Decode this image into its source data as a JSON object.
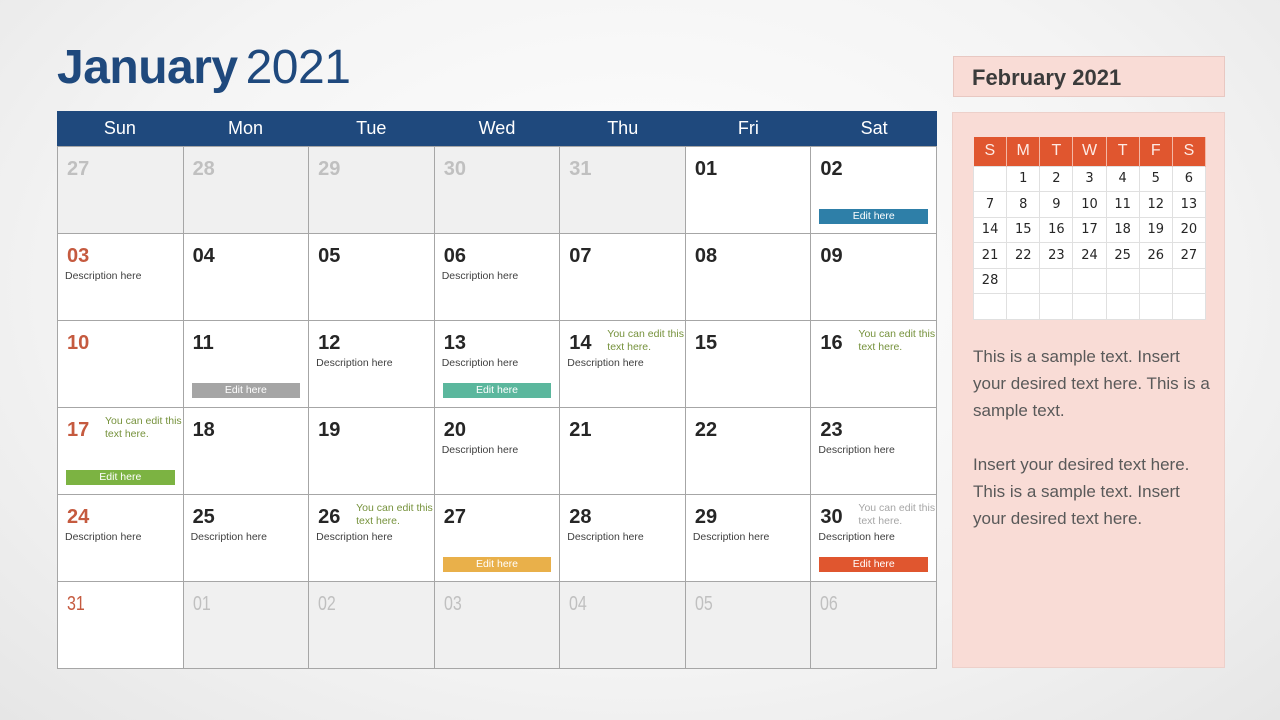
{
  "title": {
    "month": "January",
    "year": "2021"
  },
  "weekdays": [
    "Sun",
    "Mon",
    "Tue",
    "Wed",
    "Thu",
    "Fri",
    "Sat"
  ],
  "colors": {
    "header": "#1f497d",
    "sunday": "#c55a3f",
    "bar_blue": "#2e7fa8",
    "bar_grey": "#a5a5a5",
    "bar_teal": "#5bb79d",
    "bar_green": "#7cb342",
    "bar_yellow": "#e9b04a",
    "bar_orange": "#e0562f"
  },
  "weeks": [
    [
      {
        "day": "27",
        "muted": true
      },
      {
        "day": "28",
        "muted": true
      },
      {
        "day": "29",
        "muted": true
      },
      {
        "day": "30",
        "muted": true
      },
      {
        "day": "31",
        "muted": true
      },
      {
        "day": "01"
      },
      {
        "day": "02",
        "bar": "Edit here",
        "bar_color": "#2e7fa8"
      }
    ],
    [
      {
        "day": "03",
        "desc": "Description here"
      },
      {
        "day": "04"
      },
      {
        "day": "05"
      },
      {
        "day": "06",
        "desc": "Description here"
      },
      {
        "day": "07"
      },
      {
        "day": "08"
      },
      {
        "day": "09"
      }
    ],
    [
      {
        "day": "10"
      },
      {
        "day": "11",
        "bar": "Edit here",
        "bar_color": "#a5a5a5"
      },
      {
        "day": "12",
        "desc": "Description here"
      },
      {
        "day": "13",
        "desc": "Description here",
        "bar": "Edit here",
        "bar_color": "#5bb79d"
      },
      {
        "day": "14",
        "desc": "Description here",
        "note": "You can edit this text here."
      },
      {
        "day": "15"
      },
      {
        "day": "16",
        "note": "You can edit this text here."
      }
    ],
    [
      {
        "day": "17",
        "note": "You can edit this text here.",
        "bar": "Edit here",
        "bar_color": "#7cb342"
      },
      {
        "day": "18"
      },
      {
        "day": "19"
      },
      {
        "day": "20",
        "desc": "Description here"
      },
      {
        "day": "21"
      },
      {
        "day": "22"
      },
      {
        "day": "23",
        "desc": "Description here"
      }
    ],
    [
      {
        "day": "24",
        "desc": "Description here"
      },
      {
        "day": "25",
        "desc": "Description here"
      },
      {
        "day": "26",
        "desc": "Description here",
        "note": "You can edit this text here."
      },
      {
        "day": "27",
        "bar": "Edit here",
        "bar_color": "#e9b04a"
      },
      {
        "day": "28",
        "desc": "Description here"
      },
      {
        "day": "29",
        "desc": "Description here"
      },
      {
        "day": "30",
        "desc": "Description here",
        "note": "You can edit this text here.",
        "note_grey": true,
        "bar": "Edit here",
        "bar_color": "#e0562f"
      }
    ],
    [
      {
        "day": "31"
      },
      {
        "day": "01",
        "muted": true
      },
      {
        "day": "02",
        "muted": true
      },
      {
        "day": "03",
        "muted": true
      },
      {
        "day": "04",
        "muted": true
      },
      {
        "day": "05",
        "muted": true
      },
      {
        "day": "06",
        "muted": true
      }
    ]
  ],
  "sidebar": {
    "title": "February 2021",
    "mini_headers": [
      "S",
      "M",
      "T",
      "W",
      "T",
      "F",
      "S"
    ],
    "mini_weeks": [
      [
        "",
        "1",
        "2",
        "3",
        "4",
        "5",
        "6"
      ],
      [
        "7",
        "8",
        "9",
        "10",
        "11",
        "12",
        "13"
      ],
      [
        "14",
        "15",
        "16",
        "17",
        "18",
        "19",
        "20"
      ],
      [
        "21",
        "22",
        "23",
        "24",
        "25",
        "26",
        "27"
      ],
      [
        "28",
        "",
        "",
        "",
        "",
        "",
        ""
      ],
      [
        "",
        "",
        "",
        "",
        "",
        "",
        ""
      ]
    ],
    "paragraphs": [
      "This is a sample text. Insert your desired text here. This is a sample text.",
      "Insert your desired text here. This is a sample text. Insert your desired text here."
    ]
  }
}
